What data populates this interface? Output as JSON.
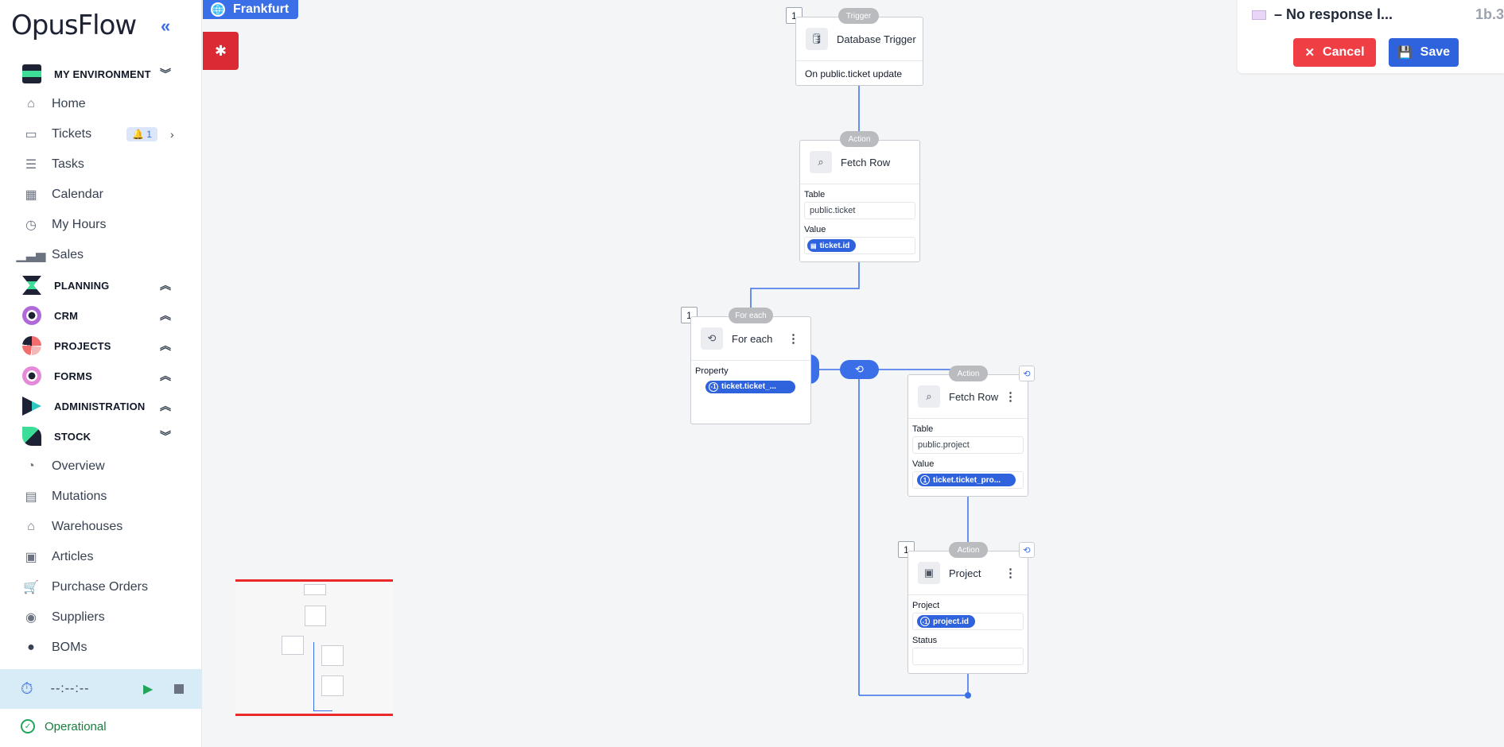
{
  "app": {
    "logo": "OpusFlow"
  },
  "sidebar": {
    "items": [
      {
        "type": "section",
        "label": "MY ENVIRONMENT",
        "chev": "⌄"
      },
      {
        "type": "item",
        "label": "Home",
        "icon": "home-icon"
      },
      {
        "type": "item",
        "label": "Tickets",
        "icon": "ticket-icon",
        "badge": "1"
      },
      {
        "type": "item",
        "label": "Tasks",
        "icon": "tasks-icon"
      },
      {
        "type": "item",
        "label": "Calendar",
        "icon": "calendar-icon"
      },
      {
        "type": "item",
        "label": "My Hours",
        "icon": "hours-icon"
      },
      {
        "type": "item",
        "label": "Sales",
        "icon": "sales-icon"
      },
      {
        "type": "section",
        "label": "PLANNING"
      },
      {
        "type": "section",
        "label": "CRM"
      },
      {
        "type": "section",
        "label": "PROJECTS"
      },
      {
        "type": "section",
        "label": "FORMS"
      },
      {
        "type": "section",
        "label": "ADMINISTRATION"
      },
      {
        "type": "section",
        "label": "STOCK"
      },
      {
        "type": "item",
        "label": "Overview",
        "icon": "overview-icon"
      },
      {
        "type": "item",
        "label": "Mutations",
        "icon": "mutations-icon"
      },
      {
        "type": "item",
        "label": "Warehouses",
        "icon": "warehouse-icon"
      },
      {
        "type": "item",
        "label": "Articles",
        "icon": "articles-icon"
      },
      {
        "type": "item",
        "label": "Purchase Orders",
        "icon": "cart-icon"
      },
      {
        "type": "item",
        "label": "Suppliers",
        "icon": "suppliers-icon"
      },
      {
        "type": "item",
        "label": "BOMs",
        "icon": "bom-icon"
      }
    ],
    "timer": "--:--:--",
    "status": "Operational"
  },
  "header": {
    "location": "Frankfurt",
    "title": "– No response l...",
    "code": "1b.3",
    "cancel": "Cancel",
    "save": "Save"
  },
  "flow": {
    "trigger": {
      "tag": "Trigger",
      "count": "1",
      "title": "Database Trigger",
      "desc": "On public.ticket update"
    },
    "fetch1": {
      "tag": "Action",
      "title": "Fetch Row",
      "table_label": "Table",
      "table": "public.ticket",
      "value_label": "Value",
      "value": "ticket.id"
    },
    "foreach": {
      "tag": "For each",
      "count": "1",
      "title": "For each",
      "prop_label": "Property",
      "prop": "ticket.ticket_...",
      "prop_badge": "-1"
    },
    "fetch2": {
      "tag": "Action",
      "title": "Fetch Row",
      "table_label": "Table",
      "table": "public.project",
      "value_label": "Value",
      "value": "ticket.ticket_pro...",
      "value_badge": "1"
    },
    "project": {
      "tag": "Action",
      "count": "1",
      "title": "Project",
      "proj_label": "Project",
      "proj": "project.id",
      "proj_badge": "-1",
      "status_label": "Status",
      "status": ""
    }
  },
  "colors": {
    "accent": "#3b6fe8",
    "danger": "#ef3f44",
    "save": "#2f62dd",
    "operational": "#15803d"
  }
}
